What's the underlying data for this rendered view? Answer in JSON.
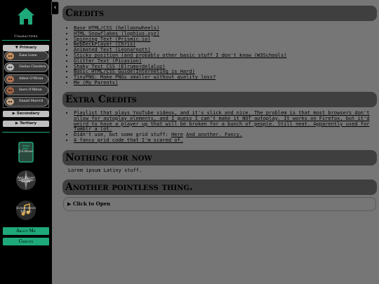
{
  "sidebar": {
    "section_label": "Characters",
    "primary_label": "▼ Primary",
    "characters": [
      {
        "name": "Zane Lowe",
        "color": "#c08a5c"
      },
      {
        "name": "Gisilus Claudera",
        "color": "#b9b9b9"
      },
      {
        "name": "Abbot O'Miran",
        "color": "#b07050"
      },
      {
        "name": "Isuro O'Miran",
        "color": "#a06040"
      },
      {
        "name": "Daniel Marovil",
        "color": "#c0a080"
      }
    ],
    "secondary_label": "▶ Secondary",
    "tertiary_label": "▶ Tertiary",
    "badges": [
      {
        "text": "Journal"
      },
      {
        "text": "Art Fight Lore"
      },
      {
        "text": "Something Music"
      }
    ],
    "about_label": "About Me",
    "credits_label": "Credits",
    "accent": "#1fa87a"
  },
  "main": {
    "credits_title": "Credits",
    "credits": [
      "Base HTML/CSS (hellaonwheels)",
      "HTML Snowflakes (lophius.xyz)",
      "Spinning Text (Prismic.io)",
      "WebDeckPlayer (Chris)",
      "Animated Text (Leonarnott)",
      "Sticky position (and probably other basic stuff I don't know (W3Schools)",
      "Glitter Text (Picasion)",
      "Shaky Text CSS (Elrumordelaluz)",
      "Basic HTML/CSS Guide(Interneting is Hard)",
      "TinyPNG: Make PNGs smaller without quality loss?",
      "Me (My Parents)"
    ],
    "extra_title": "Extra Credits",
    "extra_playlist": [
      "Playlist that plays YouTube videos, and it's slick and nice. The problem is that most browsers don't",
      "allow for autoplay elements, and I guess I can't make it NOT autoplay. It works on Firefox, but it'd",
      "weird to have a player up that will be broken for a bunch of people. Still neat. Apparently used for",
      "Tumblr a lot."
    ],
    "extra_grid_prefix": "Didn't use, but some grid stuff: ",
    "extra_grid_link1": "Here",
    "extra_grid_sep": " ",
    "extra_grid_link2": "And another. Fancy.",
    "extra_fancy": "A fancy grid code that I'm scared of.",
    "nothing_title": "Nothing for now",
    "lorem": "Lorem ipsum Latiny stuff.",
    "pointless_title": "Another pointless thing.",
    "click_open": "▶ Click to Open"
  }
}
